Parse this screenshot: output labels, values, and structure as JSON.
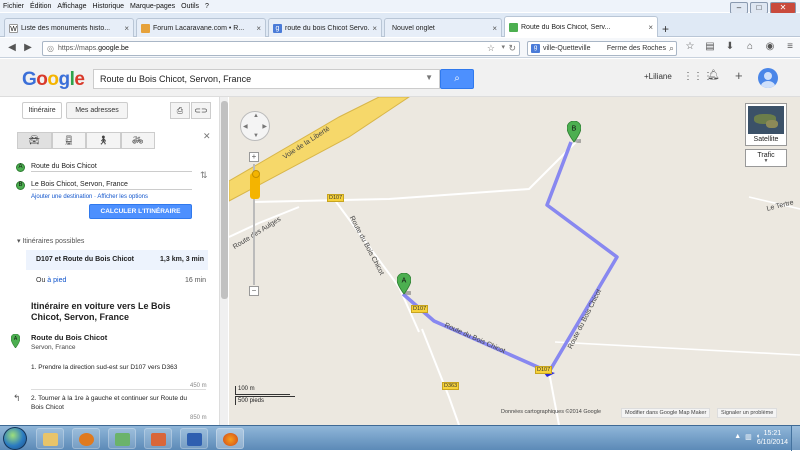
{
  "menubar": {
    "items": [
      "Fichier",
      "Édition",
      "Affichage",
      "Historique",
      "Marque-pages",
      "Outils",
      "?"
    ]
  },
  "tabs": [
    {
      "label": "Liste des monuments histo...",
      "icon": "wikipedia-icon",
      "active": false
    },
    {
      "label": "Forum Lacaravane.com • R...",
      "icon": "forum-icon",
      "active": false
    },
    {
      "label": "route du bois Chicot Servo...",
      "icon": "google-icon",
      "active": false
    },
    {
      "label": "Nouvel onglet",
      "icon": "",
      "active": false
    },
    {
      "label": "Route du Bois Chicot, Serv...",
      "icon": "maps-icon",
      "active": true
    }
  ],
  "url": {
    "prefix": "https://maps.",
    "domain": "google.be"
  },
  "searchbar": {
    "value": "ville-Quetteville",
    "value2": "Ferme des Roches"
  },
  "google": {
    "logo": "Google",
    "query": "Route du Bois Chicot, Servon, France",
    "user": "+Liliane",
    "logo_colors": [
      "#3b6fd8",
      "#d93a2b",
      "#f4b400",
      "#3b6fd8",
      "#2fa34a",
      "#d93a2b"
    ]
  },
  "panel": {
    "itinerary_tab": "Itinéraire",
    "addresses_tab": "Mes adresses",
    "from": "Route du Bois Chicot",
    "to": "Le Bois Chicot, Servon, France",
    "marker_a": "A",
    "marker_b": "B",
    "add_dest": "Ajouter une destination",
    "options": "Afficher les options",
    "calc_button": "CALCULER L'ITINÉRAIRE",
    "routes_header": "Itinéraires possibles",
    "route1": {
      "name": "D107 et Route du Bois Chicot",
      "summary": "1,3 km, 3 min"
    },
    "walk": {
      "prefix": "Ou ",
      "link": "à pied",
      "time": "16 min"
    },
    "itinerary_title": "Itinéraire en voiture vers Le Bois Chicot, Servon, France",
    "start_name": "Route du Bois Chicot",
    "start_sub": "Servon, France",
    "step1": "1. Prendre la direction sud-est sur D107 vers D363",
    "step1_dist": "450 m",
    "step2": "2. Tourner à la 1re à gauche et continuer sur Route du Bois Chicot",
    "step2_dist": "850 m"
  },
  "map": {
    "labels": {
      "voie": "Voie de la Liberté",
      "d107_top": "D107",
      "route_des_aulges": "Route des Aulges",
      "route_bois_vertical": "Route du Bois Chicot",
      "route_bois_diag": "Route du Bois Chicot",
      "route_bois_right": "Route du Bois Chicot",
      "le_tertre": "Le Tertre",
      "d107_mid": "D107",
      "d363": "D363",
      "d107_bottom": "D107"
    },
    "marker_a": "A",
    "marker_b": "B",
    "satellite_label": "Satellite",
    "traffic_label": "Trafic",
    "scale_m": "100 m",
    "scale_ft": "500 pieds",
    "attribution": "Données cartographiques ©2014 Google",
    "modify": "Modifier dans Google Map Maker",
    "report": "Signaler un problème",
    "route_color": "#7b7bf0",
    "road_yellow": "#f6d86a"
  },
  "taskbar": {
    "time": "15:21",
    "date": "6/10/2014",
    "apps": [
      "explorer-icon",
      "media-player-icon",
      "recycle-icon",
      "mail-icon",
      "word-icon",
      "firefox-icon"
    ]
  }
}
